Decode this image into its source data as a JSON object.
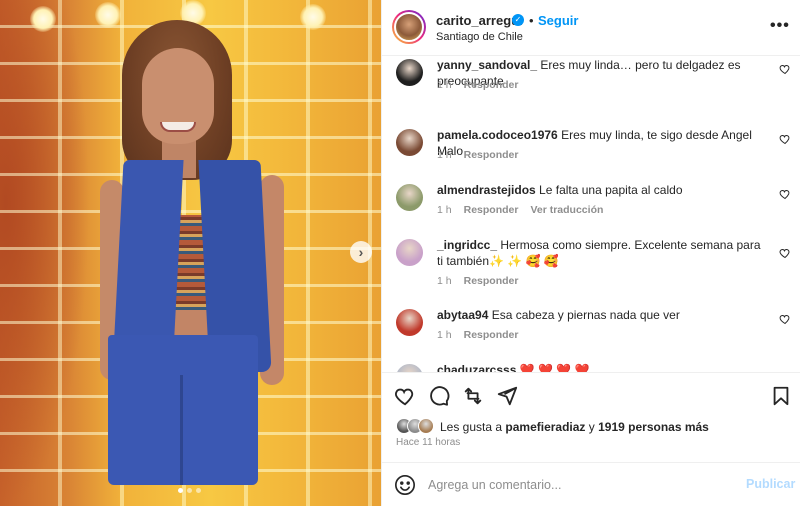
{
  "post": {
    "username": "carito_arregui",
    "verified": true,
    "separator": "•",
    "follow_label": "Seguir",
    "location": "Santiago de Chile",
    "more_icon": "more-horizontal-icon",
    "more_label": "•••"
  },
  "carousel": {
    "next_icon": "chevron-right-icon",
    "next_label": "›",
    "slide_count": 3,
    "active_slide": 1
  },
  "comments": [
    {
      "user": "yanny_sandoval_",
      "text": "Eres muy linda… pero tu delgadez es preocupante",
      "time": "1 h",
      "reply": "Responder",
      "translate": "",
      "avatar_color": "#1f1f1f"
    },
    {
      "user": "pamela.codoceo1976",
      "text": "Eres muy linda, te sigo desde Angel Malo",
      "time": "1 h",
      "reply": "Responder",
      "translate": "",
      "avatar_color": "#7a4a34"
    },
    {
      "user": "almendrastejidos",
      "text": "Le falta una papita al caldo",
      "time": "1 h",
      "reply": "Responder",
      "translate": "Ver traducción",
      "avatar_color": "#8c9a6a"
    },
    {
      "user": "_ingridcc_",
      "text": "Hermosa como siempre. Excelente semana para ti también✨ ✨ 🥰 🥰",
      "time": "1 h",
      "reply": "Responder",
      "translate": "",
      "avatar_color": "#c9a1c9"
    },
    {
      "user": "abytaa94",
      "text": "Esa cabeza y piernas nada que ver",
      "time": "1 h",
      "reply": "Responder",
      "translate": "",
      "avatar_color": "#c0392b"
    },
    {
      "user": "chaduzarcsss",
      "text": "❤️ ❤️ ❤️ ❤️",
      "time": "",
      "reply": "",
      "translate": "",
      "avatar_color": "#b0b8c8"
    }
  ],
  "actions": {
    "like_icon": "heart-icon",
    "comment_icon": "comment-icon",
    "share_icon": "share-icon",
    "send_icon": "send-icon",
    "save_icon": "bookmark-icon"
  },
  "likes": {
    "prefix": "Les gusta a ",
    "user": "pamefieradiaz",
    "middle": " y ",
    "count_text": "1919 personas más",
    "avatar_colors": [
      "#555555",
      "#8b8b8b",
      "#a67c52"
    ]
  },
  "timestamp": "Hace 11 horas",
  "comment_box": {
    "emoji_icon": "emoji-icon",
    "placeholder": "Agrega un comentario...",
    "publish_label": "Publicar"
  },
  "colors": {
    "accent": "#0095f6",
    "publish_disabled": "#b3dbff",
    "muted": "#8e8e8e",
    "text": "#262626"
  }
}
